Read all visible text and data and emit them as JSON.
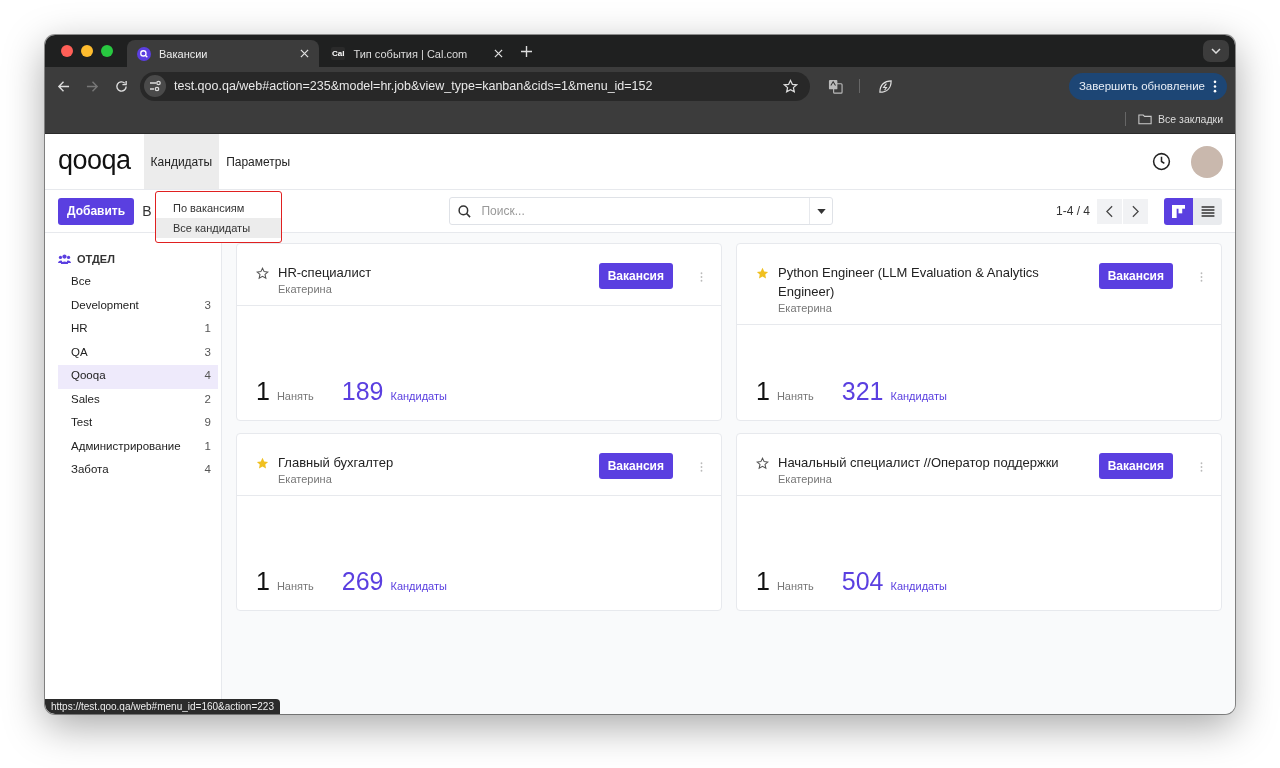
{
  "browser": {
    "tabs": [
      {
        "title": "Вакансии",
        "selected": true,
        "kind": "glyph"
      },
      {
        "title": "Тип события | Cal.com",
        "selected": false,
        "kind": "text",
        "icon_text": "Cal"
      }
    ],
    "address": "test.qoo.qa/web#action=235&model=hr.job&view_type=kanban&cids=1&menu_id=152",
    "update_button": "Завершить обновление",
    "bookmarks": "Все закладки"
  },
  "app": {
    "logo": "qooqa",
    "menu": [
      {
        "label": "Кандидаты",
        "expanded": true
      },
      {
        "label": "Параметры",
        "expanded": false
      }
    ],
    "dropdown": [
      {
        "label": "По вакансиям",
        "selected": false
      },
      {
        "label": "Все кандидаты",
        "selected": true
      }
    ],
    "add_button": "Добавить",
    "breadcrumb": "В",
    "search": {
      "placeholder": "Поиск..."
    },
    "pager": "1-4 / 4",
    "views": [
      {
        "kind": "kanban",
        "selected": true
      },
      {
        "kind": "list",
        "selected": false
      }
    ]
  },
  "sidebar": {
    "title": "ОТДЕЛ",
    "items": [
      {
        "label": "Все",
        "selected": false
      },
      {
        "label": "Development",
        "count": "3",
        "selected": false
      },
      {
        "label": "HR",
        "count": "1",
        "selected": false
      },
      {
        "label": "QA",
        "count": "3",
        "selected": false
      },
      {
        "label": "Qooqa",
        "count": "4",
        "selected": true
      },
      {
        "label": "Sales",
        "count": "2",
        "selected": false
      },
      {
        "label": "Test",
        "count": "9",
        "selected": false
      },
      {
        "label": "Администрирование",
        "count": "1",
        "selected": false
      },
      {
        "label": "Забота",
        "count": "4",
        "selected": false
      }
    ]
  },
  "cards": [
    {
      "title": "HR-специалист",
      "favorite": false,
      "manager": "Екатерина",
      "button": "Вакансия",
      "hire_count": "1",
      "hire_label": "Нанять",
      "candidates_count": "189",
      "candidates_label": "Кандидаты"
    },
    {
      "title": "Python Engineer (LLM Evaluation & Analytics Engineer)",
      "favorite": true,
      "manager": "Екатерина",
      "button": "Вакансия",
      "hire_count": "1",
      "hire_label": "Нанять",
      "candidates_count": "321",
      "candidates_label": "Кандидаты"
    },
    {
      "title": "Главный бухгалтер",
      "favorite": true,
      "manager": "Екатерина",
      "button": "Вакансия",
      "hire_count": "1",
      "hire_label": "Нанять",
      "candidates_count": "269",
      "candidates_label": "Кандидаты"
    },
    {
      "title": "Начальный специалист //Оператор поддержки",
      "favorite": false,
      "manager": "Екатерина",
      "button": "Вакансия",
      "hire_count": "1",
      "hire_label": "Нанять",
      "candidates_count": "504",
      "candidates_label": "Кандидаты"
    }
  ],
  "status_link": "https://test.qoo.qa/web#menu_id=160&action=223"
}
